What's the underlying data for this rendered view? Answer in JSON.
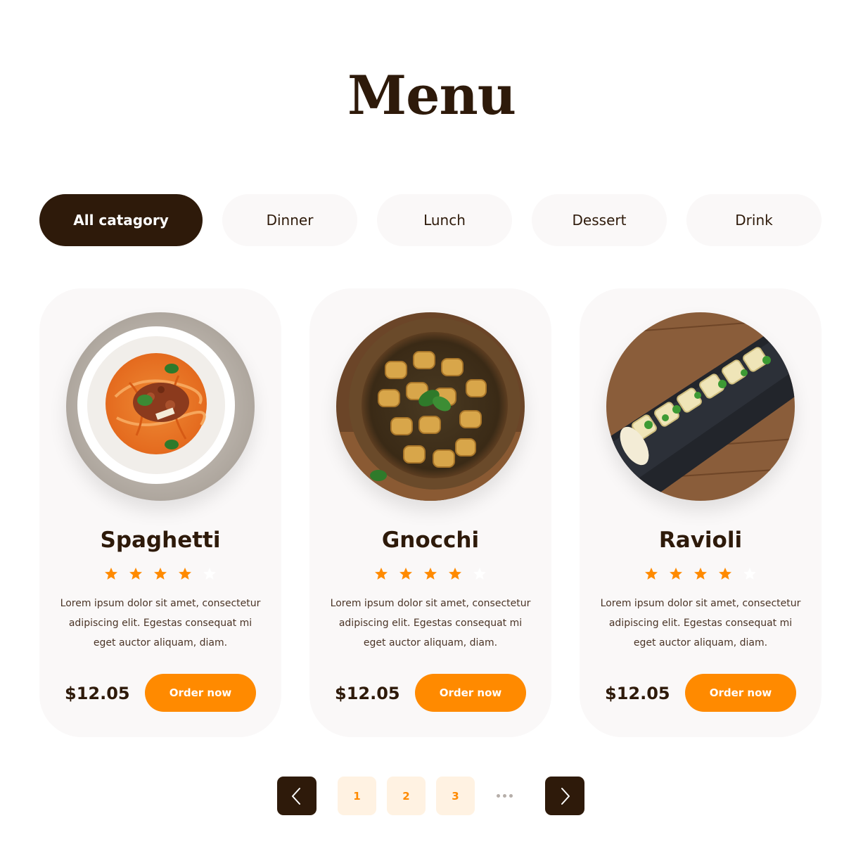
{
  "page_title": "Menu",
  "categories": [
    {
      "label": "All catagory",
      "active": true
    },
    {
      "label": "Dinner",
      "active": false
    },
    {
      "label": "Lunch",
      "active": false
    },
    {
      "label": "Dessert",
      "active": false
    },
    {
      "label": "Drink",
      "active": false
    }
  ],
  "dishes": [
    {
      "name": "Spaghetti",
      "rating": 4,
      "rating_max": 5,
      "description": "Lorem ipsum dolor sit amet, consectetur adipiscing elit. Egestas consequat mi eget auctor aliquam, diam.",
      "price": "$12.05",
      "order_label": "Order now"
    },
    {
      "name": "Gnocchi",
      "rating": 4,
      "rating_max": 5,
      "description": "Lorem ipsum dolor sit amet, consectetur adipiscing elit. Egestas consequat mi eget auctor aliquam, diam.",
      "price": "$12.05",
      "order_label": "Order now"
    },
    {
      "name": "Ravioli",
      "rating": 4,
      "rating_max": 5,
      "description": "Lorem ipsum dolor sit amet, consectetur adipiscing elit. Egestas consequat mi eget auctor aliquam, diam.",
      "price": "$12.05",
      "order_label": "Order now"
    }
  ],
  "pagination": {
    "pages": [
      "1",
      "2",
      "3"
    ],
    "prev_icon": "chevron-left-icon",
    "next_icon": "chevron-right-icon",
    "more_icon": "ellipsis-icon"
  },
  "colors": {
    "primary_dark": "#2e1a0a",
    "accent": "#ff8a00",
    "card_bg": "#faf8f8",
    "star_empty": "#ffffff"
  }
}
